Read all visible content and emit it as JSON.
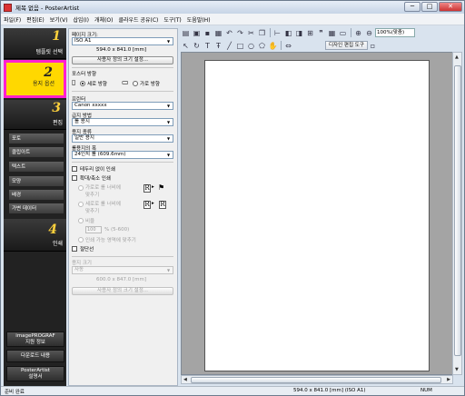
{
  "window": {
    "title": "제목 없음 - PosterArtist",
    "controls": [
      "─",
      "□",
      "✕"
    ]
  },
  "menu": [
    "파일(F)",
    "편집(E)",
    "보기(V)",
    "삽입(I)",
    "개체(O)",
    "클라우드 공유(C)",
    "도구(T)",
    "도움말(H)"
  ],
  "sidebar": {
    "steps": [
      {
        "num": "1",
        "label": "템플릿 선택"
      },
      {
        "num": "2",
        "label": "용지 옵션"
      },
      {
        "num": "3",
        "label": "편집"
      },
      {
        "num": "4",
        "label": "인쇄"
      }
    ],
    "edit_items": [
      "포토",
      "클립아트",
      "텍스트",
      "모양",
      "배경",
      "가변 데이터"
    ],
    "bottom": {
      "imageprograf": [
        "imagePROGRAF",
        "지원 정보"
      ],
      "download": "다운로드 내용",
      "posterartist": [
        "PosterArtist",
        "설명서"
      ]
    }
  },
  "panel": {
    "page_size_label": "페이지 크기:",
    "page_size_value": "ISO A1",
    "page_dims": "594.0 x 841.0 [mm]",
    "custom_size_button": "사용자 정의 크기 설정...",
    "orientation_label": "포스터 방향",
    "orientation_portrait": "세로 방향",
    "orientation_landscape": "가로 방향",
    "printer_label": "프린터",
    "printer_value": "Canon xxxxx",
    "feed_label": "급지 방법",
    "feed_value": "롤 용지",
    "paper_type_label": "용지 종류",
    "paper_type_value": "일반 용지",
    "roll_width_label": "롤용지의 폭",
    "roll_width_value": "24인치 롤 (609.6mm)",
    "borderless": "테두리 없이 인쇄",
    "scale_print": "확대/축소 인쇄",
    "fit_roll_landscape": [
      "가로로 롤 너비에",
      "맞추기"
    ],
    "fit_roll_portrait": [
      "세로로 롤 너비에",
      "맞추기"
    ],
    "ratio": "비율",
    "ratio_value": "100",
    "ratio_unit": "% (5-600)",
    "fit_printable": "인쇄 가능 영역에 맞추기",
    "cut_line": "절단선",
    "paper_size_label": "용지 크기",
    "paper_size_value": "자동",
    "paper_dims": "600.0 x 847.0 [mm]",
    "custom_size_button2": "사용자 정의 크기 설정..."
  },
  "toolbar": {
    "zoom": "100%(맞춤)",
    "layout_tool_button": "디자인 편집 도구"
  },
  "status": {
    "left": "준비 완료",
    "dims": "594.0 x 841.0 [mm] (ISO A1)",
    "num": "NUM"
  }
}
